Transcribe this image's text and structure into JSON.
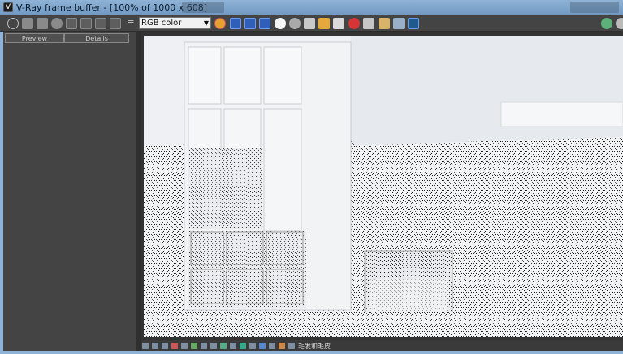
{
  "window": {
    "title": "V-Ray frame buffer - [100% of 1000 x 608]",
    "app_icon": "vray-icon"
  },
  "toolbar": {
    "channel": "RGB color",
    "tools_left": [
      "power-icon",
      "save-icon",
      "save-all-icon",
      "clear-icon",
      "layer-icon",
      "text-icon",
      "compare-icon",
      "image-icon",
      "menu-icon"
    ],
    "tools_right": [
      "region-icon",
      "red-channel-icon",
      "green-channel-icon",
      "blue-channel-icon",
      "alpha-icon",
      "mono-icon",
      "save-image-icon",
      "load-image-icon",
      "history-icon",
      "stop-icon",
      "render-icon",
      "follow-mouse-icon",
      "lens-icon",
      "settings-icon"
    ]
  },
  "left_panel": {
    "tabs": [
      "Preview",
      "Details"
    ]
  },
  "statusbar": {
    "text": "毛发和毛皮"
  },
  "colors": {
    "titlebar": "#7da6cf",
    "toolbar": "#444444",
    "panel": "#3c3c3c",
    "render_bg": "#eceef1"
  }
}
